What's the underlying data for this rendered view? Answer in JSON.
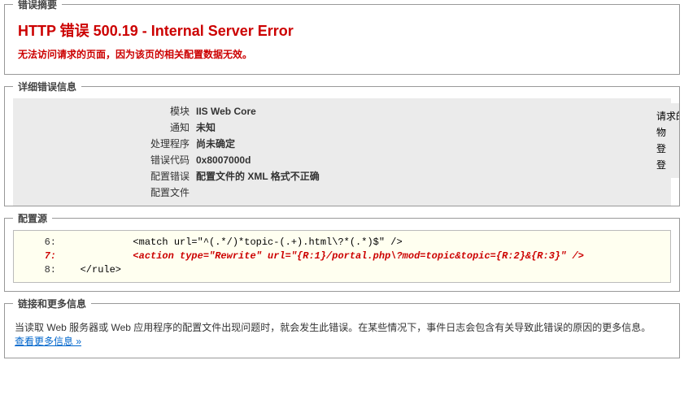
{
  "summary": {
    "section_title": "错误摘要",
    "title": "HTTP 错误 500.19 - Internal Server Error",
    "subtitle": "无法访问请求的页面，因为该页的相关配置数据无效。"
  },
  "details": {
    "section_title": "详细错误信息",
    "rows": [
      {
        "label": "模块",
        "value": "IIS Web Core"
      },
      {
        "label": "通知",
        "value": "未知"
      },
      {
        "label": "处理程序",
        "value": "尚未确定"
      },
      {
        "label": "错误代码",
        "value": "0x8007000d"
      },
      {
        "label": "配置错误",
        "value": "配置文件的 XML 格式不正确"
      },
      {
        "label": "配置文件",
        "value": " "
      }
    ],
    "right_rows": [
      "请求的",
      "物",
      "登",
      "登"
    ]
  },
  "config_source": {
    "section_title": "配置源",
    "lines": [
      {
        "no": "6:",
        "code": "            <match url=\"^(.*/)*topic-(.+).html\\?*(.*)$\" />",
        "err": false
      },
      {
        "no": "7:",
        "code": "            <action type=\"Rewrite\" url=\"{R:1}/portal.php\\?mod=topic&topic={R:2}&{R:3}\" />",
        "err": true
      },
      {
        "no": "8:",
        "code": "   </rule>",
        "err": false
      }
    ]
  },
  "links": {
    "section_title": "链接和更多信息",
    "text": "当读取 Web 服务器或 Web 应用程序的配置文件出现问题时，就会发生此错误。在某些情况下，事件日志会包含有关导致此错误的原因的更多信息。",
    "link_label": "查看更多信息 »"
  }
}
